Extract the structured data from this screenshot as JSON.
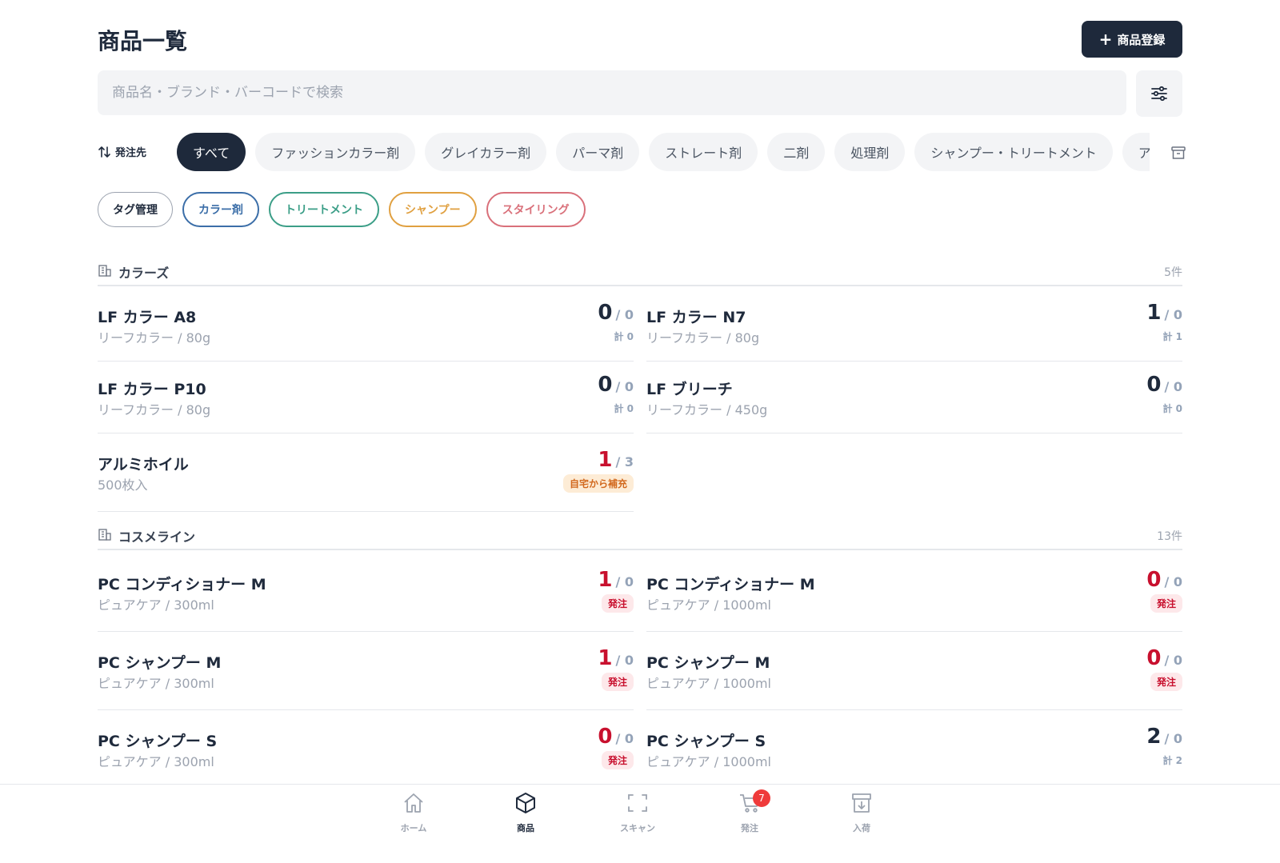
{
  "header": {
    "title": "商品一覧",
    "add_button_label": "商品登録"
  },
  "search": {
    "placeholder": "商品名・ブランド・バーコードで検索"
  },
  "sort": {
    "label": "発注先"
  },
  "categories": [
    {
      "label": "すべて",
      "active": true
    },
    {
      "label": "ファッションカラー剤",
      "active": false
    },
    {
      "label": "グレイカラー剤",
      "active": false
    },
    {
      "label": "パーマ剤",
      "active": false
    },
    {
      "label": "ストレート剤",
      "active": false
    },
    {
      "label": "二剤",
      "active": false
    },
    {
      "label": "処理剤",
      "active": false
    },
    {
      "label": "シャンプー・トリートメント",
      "active": false
    },
    {
      "label": "ア",
      "active": false
    }
  ],
  "tags": [
    {
      "label": "タグ管理",
      "color": "#9ca3af",
      "text_color": "#1f2a3c"
    },
    {
      "label": "カラー剤",
      "color": "#3b6ea8",
      "text_color": "#3b6ea8"
    },
    {
      "label": "トリートメント",
      "color": "#3b9e87",
      "text_color": "#3b9e87"
    },
    {
      "label": "シャンプー",
      "color": "#e0a040",
      "text_color": "#e0a040"
    },
    {
      "label": "スタイリング",
      "color": "#d9707a",
      "text_color": "#d9707a"
    }
  ],
  "sections": [
    {
      "name": "カラーズ",
      "count": "5件",
      "items": [
        {
          "title": "LF カラー A8",
          "sub": "リーフカラー / 80g",
          "cur": "0",
          "max": "/ 0",
          "note": "計 0",
          "red": false
        },
        {
          "title": "LF カラー N7",
          "sub": "リーフカラー / 80g",
          "cur": "1",
          "max": "/ 0",
          "note": "計 1",
          "red": false
        },
        {
          "title": "LF カラー P10",
          "sub": "リーフカラー / 80g",
          "cur": "0",
          "max": "/ 0",
          "note": "計 0",
          "red": false
        },
        {
          "title": "LF ブリーチ",
          "sub": "リーフカラー / 450g",
          "cur": "0",
          "max": "/ 0",
          "note": "計 0",
          "red": false
        },
        {
          "title": "アルミホイル",
          "sub": "500枚入",
          "cur": "1",
          "max": "/ 3",
          "badge": "自宅から補充",
          "red": true
        }
      ]
    },
    {
      "name": "コスメライン",
      "count": "13件",
      "items": [
        {
          "title": "PC コンディショナー M",
          "sub": "ピュアケア / 300ml",
          "cur": "1",
          "max": "/ 0",
          "badge": "発注",
          "red": true
        },
        {
          "title": "PC コンディショナー M",
          "sub": "ピュアケア / 1000ml",
          "cur": "0",
          "max": "/ 0",
          "badge": "発注",
          "red": true
        },
        {
          "title": "PC シャンプー M",
          "sub": "ピュアケア / 300ml",
          "cur": "1",
          "max": "/ 0",
          "badge": "発注",
          "red": true
        },
        {
          "title": "PC シャンプー M",
          "sub": "ピュアケア / 1000ml",
          "cur": "0",
          "max": "/ 0",
          "badge": "発注",
          "red": true
        },
        {
          "title": "PC シャンプー S",
          "sub": "ピュアケア / 300ml",
          "cur": "0",
          "max": "/ 0",
          "badge": "発注",
          "red": true
        },
        {
          "title": "PC シャンプー S",
          "sub": "ピュアケア / 1000ml",
          "cur": "2",
          "max": "/ 0",
          "note": "計 2",
          "red": false
        }
      ]
    }
  ],
  "nav": [
    {
      "label": "ホーム",
      "icon": "home-icon",
      "active": false
    },
    {
      "label": "商品",
      "icon": "box-icon",
      "active": true
    },
    {
      "label": "スキャン",
      "icon": "scan-icon",
      "active": false
    },
    {
      "label": "発注",
      "icon": "cart-icon",
      "active": false,
      "badge": "7"
    },
    {
      "label": "入荷",
      "icon": "inbox-icon",
      "active": false
    }
  ],
  "colors": {
    "primary": "#1e293b",
    "alert": "#c8102e",
    "muted": "#94a3b8"
  }
}
